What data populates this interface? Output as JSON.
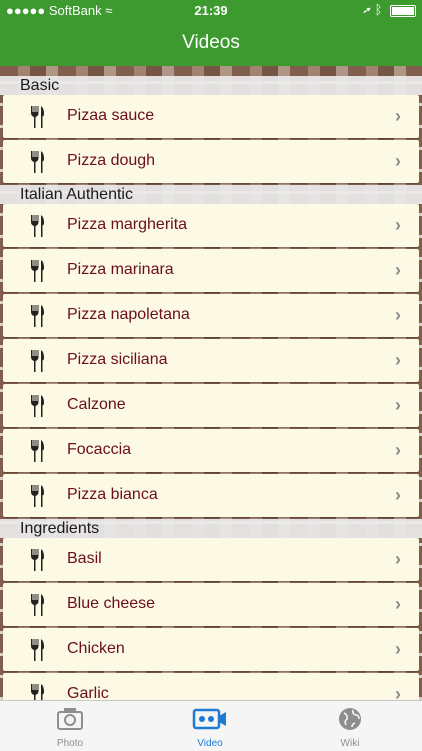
{
  "status_bar": {
    "carrier": "●●●●● SoftBank  ",
    "time": "21:39",
    "carrier_text": "SoftBank"
  },
  "nav": {
    "title": "Videos"
  },
  "sections": [
    {
      "title": "Basic",
      "items": [
        "Pizaa sauce",
        "Pizza dough"
      ]
    },
    {
      "title": "Italian Authentic",
      "items": [
        "Pizza margherita",
        "Pizza marinara",
        "Pizza napoletana",
        "Pizza siciliana",
        "Calzone",
        "Focaccia",
        "Pizza bianca"
      ]
    },
    {
      "title": "Ingredients",
      "items": [
        "Basil",
        "Blue cheese",
        "Chicken",
        "Garlic"
      ]
    }
  ],
  "row_icon": "fork-icon",
  "tabs": [
    {
      "label": "Photo",
      "icon": "camera-icon",
      "active": false
    },
    {
      "label": "Video",
      "icon": "video-camera-icon",
      "active": true
    },
    {
      "label": "Wiki",
      "icon": "globe-icon",
      "active": false
    }
  ],
  "colors": {
    "nav_green": "#3c9a2e",
    "item_text": "#6b0f1a",
    "tab_active": "#1e7ad3",
    "row_bg": "#fcf9e4"
  }
}
